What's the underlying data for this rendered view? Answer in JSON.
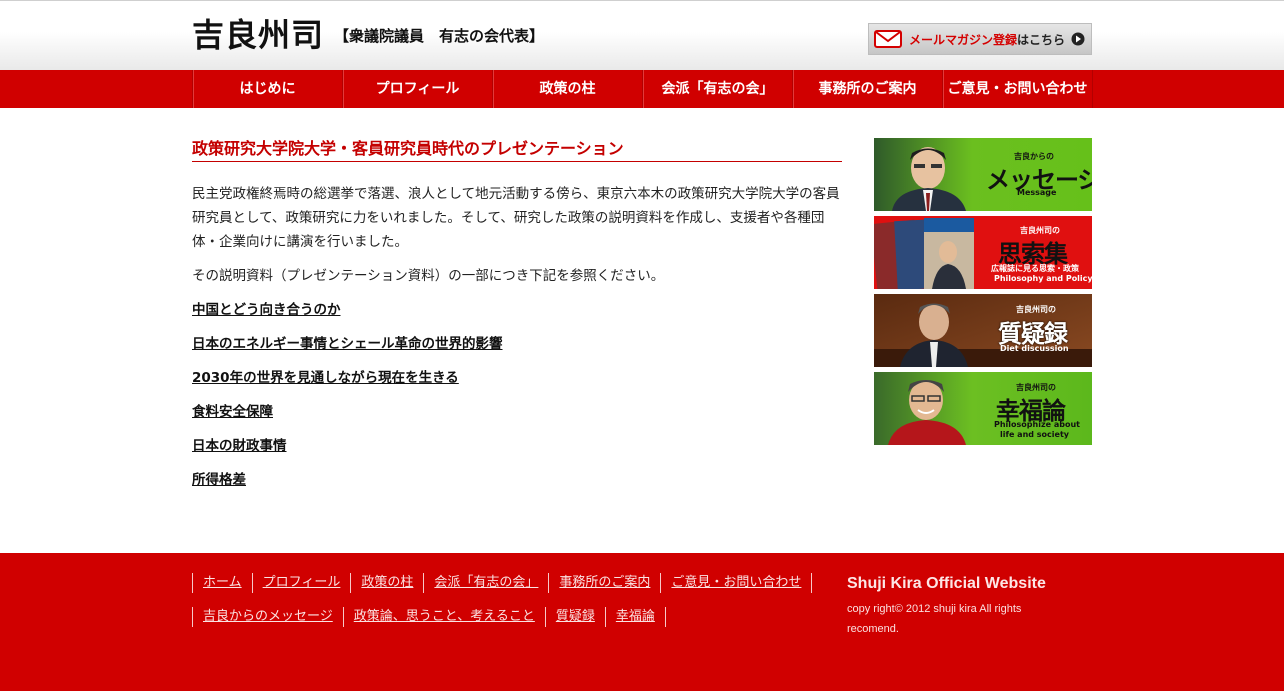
{
  "header": {
    "logo": "吉良州司",
    "tagline": "【衆議院議員　有志の会代表】",
    "mail_button": {
      "highlight": "メールマガジン登録",
      "rest": "はこちら"
    }
  },
  "nav": {
    "items": [
      "はじめに",
      "プロフィール",
      "政策の柱",
      "会派「有志の会」",
      "事務所のご案内",
      "ご意見・お問い合わせ"
    ]
  },
  "main": {
    "title": "政策研究大学院大学・客員研究員時代のプレゼンテーション",
    "para1": "民主党政権終焉時の総選挙で落選、浪人として地元活動する傍ら、東京六本木の政策研究大学院大学の客員研究員として、政策研究に力をいれました。そして、研究した政策の説明資料を作成し、支援者や各種団体・企業向けに講演を行いました。",
    "para2": "その説明資料（プレゼンテーション資料）の一部につき下記を参照ください。",
    "links": [
      "中国とどう向き合うのか",
      "日本のエネルギー事情とシェール革命の世界的影響",
      "2030年の世界を見通しながら現在を生きる",
      "食料安全保障",
      "日本の財政事情",
      "所得格差"
    ]
  },
  "sidebar": {
    "banners": [
      {
        "small": "吉良からの",
        "big": "メッセージ",
        "sub": "Message"
      },
      {
        "small": "吉良州司の",
        "big": "思索集",
        "sub": "広報誌に見る思索・政策",
        "sub2": "Philosophy and Policy"
      },
      {
        "small": "吉良州司の",
        "big": "質疑録",
        "sub": "Diet discussion"
      },
      {
        "small": "吉良州司の",
        "big": "幸福論",
        "sub": "Philosophize about",
        "sub2": "life and society"
      }
    ]
  },
  "footer": {
    "row1": [
      "ホーム",
      "プロフィール",
      "政策の柱",
      "会派「有志の会」",
      "事務所のご案内",
      "ご意見・お問い合わせ"
    ],
    "row2": [
      "吉良からのメッセージ",
      "政策論、思うこと、考えること",
      "質疑録",
      "幸福論"
    ],
    "site_name": "Shuji Kira Official Website",
    "copyright": "copy right© 2012 shuji kira All rights recomend."
  },
  "colors": {
    "brand_red": "#d00000",
    "title_red": "#c40000",
    "green": "#5cb81c"
  }
}
